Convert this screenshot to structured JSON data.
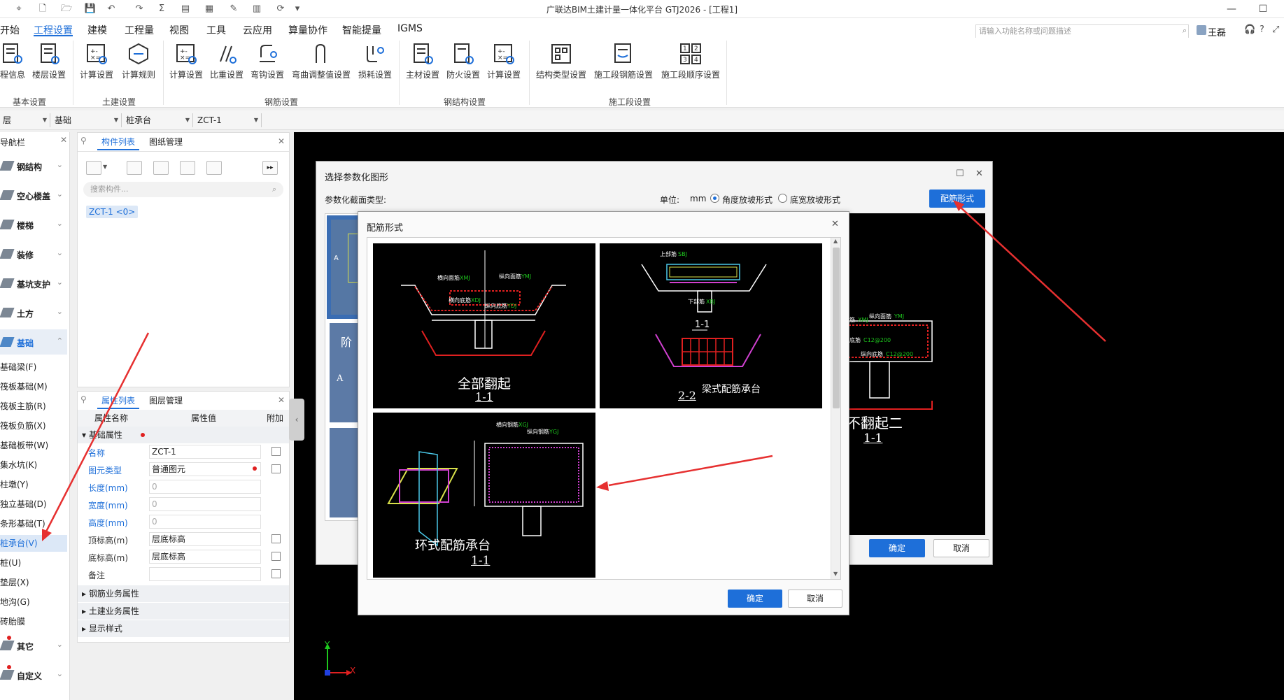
{
  "titlebar": {
    "title": "广联达BIM土建计量一体化平台 GTJ2026 - [工程1]"
  },
  "menu": {
    "items": [
      "开始",
      "工程设置",
      "建模",
      "工程量",
      "视图",
      "工具",
      "云应用",
      "算量协作",
      "智能提量",
      "IGMS"
    ],
    "active": "工程设置",
    "search_placeholder": "请输入功能名称或问题描述",
    "user": "王磊"
  },
  "ribbon": {
    "buttons": [
      "程信息",
      "楼层设置",
      "计算设置",
      "计算规则",
      "计算设置",
      "比重设置",
      "弯钩设置",
      "弯曲调整值设置",
      "损耗设置",
      "主材设置",
      "防火设置",
      "计算设置",
      "结构类型设置",
      "施工段钢筋设置",
      "施工段顺序设置"
    ],
    "groups": [
      "基本设置",
      "土建设置",
      "钢筋设置",
      "钢结构设置",
      "施工段设置"
    ]
  },
  "selectors": [
    "层",
    "基础",
    "桩承台",
    "ZCT-1"
  ],
  "nav": {
    "title": "导航栏",
    "groups_top": [
      "钢结构",
      "空心楼盖",
      "楼梯",
      "装修",
      "基坑支护",
      "土方",
      "基础"
    ],
    "subitems": [
      "基础梁(F)",
      "筏板基础(M)",
      "筏板主筋(R)",
      "筏板负筋(X)",
      "基础板带(W)",
      "集水坑(K)",
      "柱墩(Y)",
      "独立基础(D)",
      "条形基础(T)",
      "桩承台(V)",
      "桩(U)",
      "垫层(X)",
      "地沟(G)",
      "砖胎膜"
    ],
    "active_sub": "桩承台(V)",
    "groups_bottom": [
      "其它",
      "自定义"
    ]
  },
  "complist": {
    "tabs": [
      "构件列表",
      "图纸管理"
    ],
    "search_placeholder": "搜索构件...",
    "item": "ZCT-1 <0>"
  },
  "props": {
    "tabs": [
      "属性列表",
      "图层管理"
    ],
    "headers": [
      "属性名称",
      "属性值",
      "附加"
    ],
    "group": "基础属性",
    "rows": [
      {
        "name": "名称",
        "value": "ZCT-1"
      },
      {
        "name": "图元类型",
        "value": "普通图元"
      },
      {
        "name": "长度(mm)",
        "value": "0"
      },
      {
        "name": "宽度(mm)",
        "value": "0"
      },
      {
        "name": "高度(mm)",
        "value": "0"
      },
      {
        "name": "顶标高(m)",
        "value": "层底标高"
      },
      {
        "name": "底标高(m)",
        "value": "层底标高"
      },
      {
        "name": "备注",
        "value": ""
      }
    ],
    "groups_collapsed": [
      "钢筋业务属性",
      "土建业务属性",
      "显示样式"
    ]
  },
  "dialog1": {
    "title": "选择参数化图形",
    "section_label": "参数化截面类型:",
    "unit_label": "单位:",
    "unit": "mm",
    "radio1": "角度放坡形式",
    "radio2": "底宽放坡形式",
    "rebar_button": "配筋形式",
    "preview_caption": "均不翻起二",
    "preview_sub": "1-1",
    "ok": "确定",
    "cancel": "取消",
    "left_labels": [
      "A",
      "阶",
      "A"
    ]
  },
  "dialog2": {
    "title": "配筋形式",
    "thumbs": [
      {
        "caption": "全部翻起",
        "sub": "1-1"
      },
      {
        "caption": "梁式配筋承台",
        "sub": "2-2",
        "top_sub": "1-1"
      },
      {
        "caption": "环式配筋承台",
        "sub": "1-1"
      }
    ],
    "labels": [
      "横向面筋",
      "纵向面筋",
      "横向底筋",
      "纵向底筋",
      "上部筋",
      "下部筋",
      "横向钢筋",
      "纵向钢筋"
    ],
    "label_codes": [
      "XMJ",
      "YMJ",
      "XDJ",
      "YDJ",
      "SBJ",
      "XBJ",
      "XGJ",
      "YGJ"
    ],
    "ok": "确定",
    "cancel": "取消"
  },
  "axis": {
    "y": "Y",
    "x": "X"
  },
  "colors": {
    "accent": "#1e6fd9",
    "arrow": "#e63030"
  }
}
